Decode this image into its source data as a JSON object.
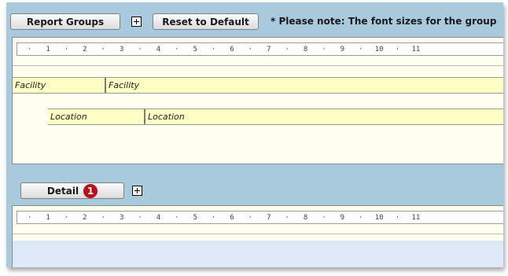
{
  "toolbar": {
    "report_groups_label": "Report Groups",
    "reset_label": "Reset to Default",
    "note": "* Please note: The font sizes for the group"
  },
  "ruler": {
    "marks": [
      "·",
      "1",
      "·",
      "2",
      "·",
      "3",
      "·",
      "4",
      "·",
      "5",
      "·",
      "6",
      "·",
      "7",
      "·",
      "8",
      "·",
      "9",
      "·",
      "10",
      "·",
      "11"
    ]
  },
  "groups": {
    "facility_label": "Facility",
    "facility_value": "Facility",
    "location_label": "Location",
    "location_value": "Location"
  },
  "detail": {
    "label": "Detail",
    "badge": "1"
  },
  "colors": {
    "background": "#a9c9dc",
    "field_fill": "#ffffc4",
    "badge": "#b5121b"
  }
}
